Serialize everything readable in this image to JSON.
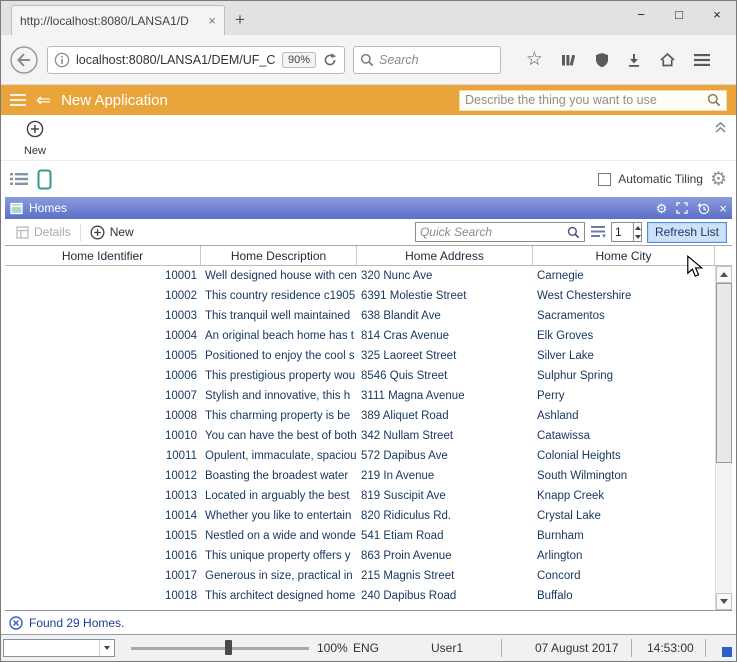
{
  "colors": {
    "brand_orange": "#e9a43c",
    "panel_blue": "#5a6fc8",
    "grid_text": "#17375e",
    "refresh_button_fill": "#cde2f8",
    "refresh_button_border": "#4f8fcc"
  },
  "icons": {
    "star": "☆",
    "gear": "⚙",
    "close": "×",
    "minimize": "−",
    "maximize": "□",
    "new_tab": "+",
    "back_double_arrow": "⇐"
  },
  "browser": {
    "tab_title": "http://localhost:8080/LANSA1/D",
    "url_value": "localhost:8080/LANSA1/DEM/UF_C",
    "zoom_badge": "90%",
    "search_placeholder": "Search"
  },
  "app_header": {
    "title": "New Application",
    "search_placeholder": "Describe the thing you want to use"
  },
  "ribbon": {
    "new_label": "New"
  },
  "layout_bar": {
    "tiling_label": "Automatic Tiling"
  },
  "panel": {
    "title": "Homes"
  },
  "grid_toolbar": {
    "details_label": "Details",
    "new_label": "New",
    "quick_search_placeholder": "Quick Search",
    "page_value": "1",
    "refresh_label": "Refresh List"
  },
  "table": {
    "columns": [
      "Home Identifier",
      "Home Description",
      "Home Address",
      "Home City"
    ],
    "rows": [
      {
        "id": "10001",
        "description": "Well designed house with cen",
        "address": "320 Nunc Ave",
        "city": "Carnegie"
      },
      {
        "id": "10002",
        "description": "This country residence c1905",
        "address": "6391 Molestie Street",
        "city": "West Chestershire"
      },
      {
        "id": "10003",
        "description": "This tranquil well maintained",
        "address": "638 Blandit Ave",
        "city": "Sacramentos"
      },
      {
        "id": "10004",
        "description": "An original beach home has t",
        "address": "814 Cras Avenue",
        "city": "Elk Groves"
      },
      {
        "id": "10005",
        "description": "Positioned to enjoy the cool s",
        "address": "325 Laoreet Street",
        "city": "Silver Lake"
      },
      {
        "id": "10006",
        "description": "This prestigious property wou",
        "address": "8546 Quis Street",
        "city": "Sulphur Spring"
      },
      {
        "id": "10007",
        "description": "Stylish and innovative, this h",
        "address": "3111 Magna Avenue",
        "city": "Perry"
      },
      {
        "id": "10008",
        "description": "This charming property is be",
        "address": "389 Aliquet Road",
        "city": "Ashland"
      },
      {
        "id": "10010",
        "description": "You can have the best of both",
        "address": "342 Nullam Street",
        "city": "Catawissa"
      },
      {
        "id": "10011",
        "description": "Opulent, immaculate, spaciou",
        "address": "572 Dapibus Ave",
        "city": "Colonial Heights"
      },
      {
        "id": "10012",
        "description": "Boasting the broadest water",
        "address": "219 In Avenue",
        "city": "South Wilmington"
      },
      {
        "id": "10013",
        "description": "Located in arguably the best",
        "address": "819 Suscipit Ave",
        "city": "Knapp Creek"
      },
      {
        "id": "10014",
        "description": "Whether you like to entertain",
        "address": "820 Ridiculus Rd.",
        "city": "Crystal Lake"
      },
      {
        "id": "10015",
        "description": "Nestled on a wide and wonde",
        "address": "541 Etiam Road",
        "city": "Burnham"
      },
      {
        "id": "10016",
        "description": "This unique property offers y",
        "address": "863 Proin Avenue",
        "city": "Arlington"
      },
      {
        "id": "10017",
        "description": "Generous in size, practical in",
        "address": "215 Magnis Street",
        "city": "Concord"
      },
      {
        "id": "10018",
        "description": "This architect designed home",
        "address": "240 Dapibus Road",
        "city": "Buffalo"
      }
    ]
  },
  "status": {
    "found_text": "Found 29 Homes."
  },
  "statusbar": {
    "zoom": "100%",
    "language": "ENG",
    "user": "User1",
    "date": "07 August 2017",
    "time": "14:53:00"
  }
}
